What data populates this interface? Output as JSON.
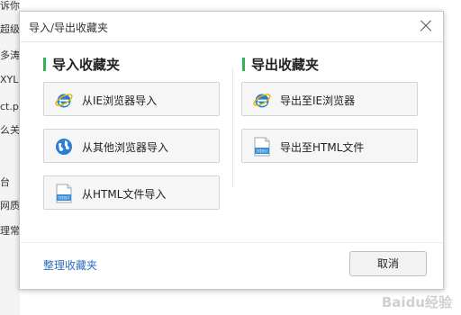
{
  "background": {
    "items": [
      "诉你",
      "超级",
      "多涛",
      "XYLIN",
      "ct.po",
      "么关",
      "台",
      "网质",
      "理常"
    ]
  },
  "dialog": {
    "title": "导入/导出收藏夹",
    "import": {
      "title": "导入收藏夹",
      "buttons": [
        {
          "label": "从IE浏览器导入",
          "icon": "ie-icon"
        },
        {
          "label": "从其他浏览器导入",
          "icon": "globe-icon"
        },
        {
          "label": "从HTML文件导入",
          "icon": "html-file-icon"
        }
      ]
    },
    "export": {
      "title": "导出收藏夹",
      "buttons": [
        {
          "label": "导出至IE浏览器",
          "icon": "ie-icon"
        },
        {
          "label": "导出至HTML文件",
          "icon": "html-file-icon"
        }
      ]
    },
    "organize_link": "整理收藏夹",
    "cancel_label": "取消"
  },
  "watermark": "Baidu经验",
  "colors": {
    "accent_green": "#2fb45c",
    "link_blue": "#2a6ebf",
    "ie_blue": "#1d7fd6"
  }
}
